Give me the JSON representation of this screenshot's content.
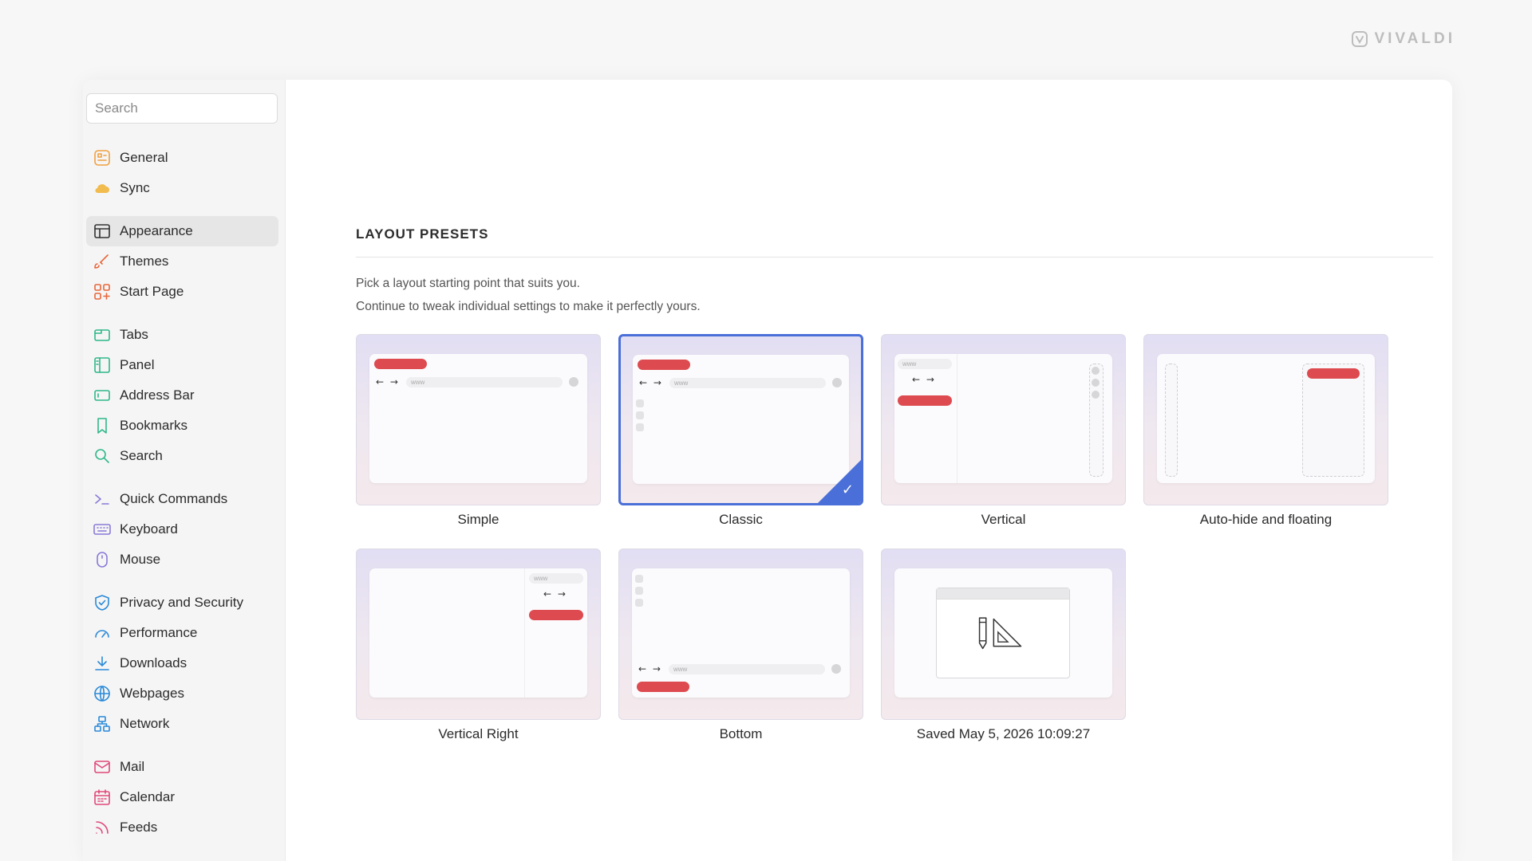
{
  "brand": {
    "name": "VIVALDI"
  },
  "sidebar": {
    "search_placeholder": "Search",
    "groups": [
      [
        {
          "label": "General",
          "icon": "general-icon",
          "color": "#f0a040"
        },
        {
          "label": "Sync",
          "icon": "cloud-icon",
          "color": "#f0b030"
        }
      ],
      [
        {
          "label": "Appearance",
          "icon": "appearance-icon",
          "color": "#333333",
          "active": true
        },
        {
          "label": "Themes",
          "icon": "brush-icon",
          "color": "#e8663a"
        },
        {
          "label": "Start Page",
          "icon": "grid-plus-icon",
          "color": "#e8663a"
        }
      ],
      [
        {
          "label": "Tabs",
          "icon": "tabs-icon",
          "color": "#2fb88a"
        },
        {
          "label": "Panel",
          "icon": "panel-icon",
          "color": "#2fb88a"
        },
        {
          "label": "Address Bar",
          "icon": "address-bar-icon",
          "color": "#2fb88a"
        },
        {
          "label": "Bookmarks",
          "icon": "bookmark-icon",
          "color": "#2fb88a"
        },
        {
          "label": "Search",
          "icon": "search-icon",
          "color": "#2fb88a"
        }
      ],
      [
        {
          "label": "Quick Commands",
          "icon": "quick-commands-icon",
          "color": "#8a7ad8"
        },
        {
          "label": "Keyboard",
          "icon": "keyboard-icon",
          "color": "#8a7ad8"
        },
        {
          "label": "Mouse",
          "icon": "mouse-icon",
          "color": "#8a7ad8"
        }
      ],
      [
        {
          "label": "Privacy and Security",
          "icon": "shield-icon",
          "color": "#2a8ad8"
        },
        {
          "label": "Performance",
          "icon": "gauge-icon",
          "color": "#2a8ad8"
        },
        {
          "label": "Downloads",
          "icon": "download-icon",
          "color": "#2a8ad8"
        },
        {
          "label": "Webpages",
          "icon": "globe-icon",
          "color": "#2a8ad8"
        },
        {
          "label": "Network",
          "icon": "network-icon",
          "color": "#2a8ad8"
        }
      ],
      [
        {
          "label": "Mail",
          "icon": "mail-icon",
          "color": "#e04a7a"
        },
        {
          "label": "Calendar",
          "icon": "calendar-icon",
          "color": "#e04a7a"
        },
        {
          "label": "Feeds",
          "icon": "rss-icon",
          "color": "#e04a7a"
        }
      ]
    ]
  },
  "main": {
    "section_title": "LAYOUT PRESETS",
    "description_line1": "Pick a layout starting point that suits you.",
    "description_line2": "Continue to tweak individual settings to make it perfectly yours.",
    "url_text": "www",
    "arrows": "← →",
    "check": "✓",
    "presets": [
      {
        "label": "Simple",
        "layout": "simple",
        "selected": false
      },
      {
        "label": "Classic",
        "layout": "classic",
        "selected": true
      },
      {
        "label": "Vertical",
        "layout": "vertical",
        "selected": false
      },
      {
        "label": "Auto-hide and floating",
        "layout": "autohide",
        "selected": false
      },
      {
        "label": "Vertical Right",
        "layout": "vertical-right",
        "selected": false
      },
      {
        "label": "Bottom",
        "layout": "bottom",
        "selected": false
      },
      {
        "label": "Saved May 5, 2026 10:09:27",
        "layout": "saved",
        "selected": false
      }
    ],
    "accent_color": "#4a6fd8",
    "tab_color": "#dd4a4f"
  }
}
